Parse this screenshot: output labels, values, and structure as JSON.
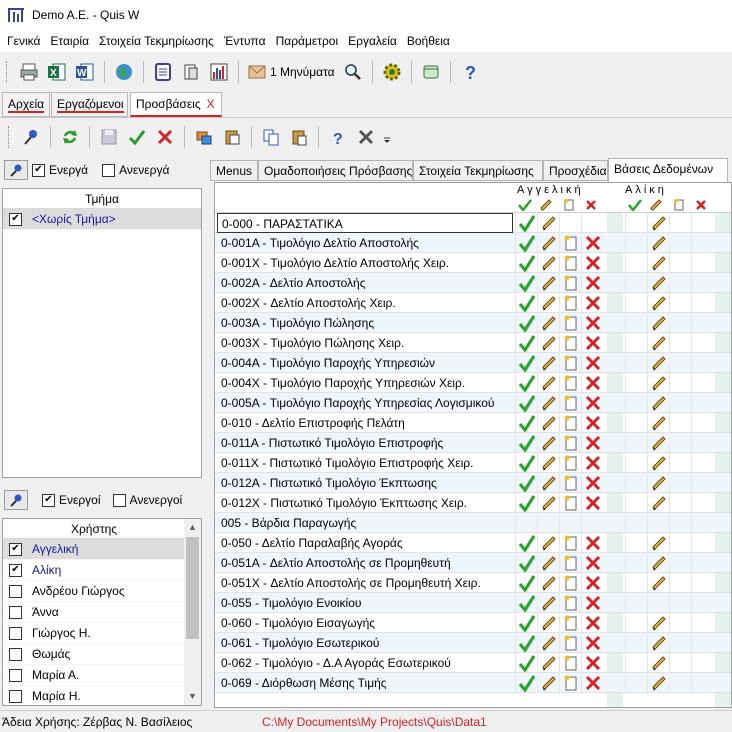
{
  "window": {
    "title": "Demo A.E. - Quis W"
  },
  "menu": [
    "Γενικά",
    "Εταιρία",
    "Στοιχεία Τεκμηρίωσης",
    "Έντυπα",
    "Παράμετροι",
    "Εργαλεία",
    "Βοήθεια"
  ],
  "toolbar": {
    "messages_label": "1 Μηνύματα"
  },
  "doc_tabs": [
    {
      "label": "Αρχεία"
    },
    {
      "label": "Εργαζόμενοι"
    },
    {
      "label": "Προσβάσεις",
      "close": "X"
    }
  ],
  "departments": {
    "active_label": "Ενεργά",
    "inactive_label": "Ανενεργά",
    "active_checked": true,
    "inactive_checked": false,
    "header": "Τμήμα",
    "items": [
      {
        "name": "<Χωρίς Τμήμα>",
        "checked": true
      }
    ]
  },
  "users": {
    "active_label": "Ενεργοί",
    "inactive_label": "Ανενεργοί",
    "active_checked": true,
    "inactive_checked": false,
    "header": "Χρήστης",
    "items": [
      {
        "name": "Αγγελική",
        "checked": true
      },
      {
        "name": "Αλίκη",
        "checked": true
      },
      {
        "name": "Ανδρέου Γιώργος",
        "checked": false
      },
      {
        "name": "Άννα",
        "checked": false
      },
      {
        "name": "Γιώργος Η.",
        "checked": false
      },
      {
        "name": "Θωμάς",
        "checked": false
      },
      {
        "name": "Μαρία Α.",
        "checked": false
      },
      {
        "name": "Μαρία Η.",
        "checked": false
      }
    ]
  },
  "grid_tabs": [
    "Menus",
    "Ομαδοποιήσεις Πρόσβασης",
    "Στοιχεία Τεκμηρίωσης",
    "Προσχέδια",
    "Βάσεις Δεδομένων"
  ],
  "grid": {
    "user_columns": [
      "Αγγελική",
      "Αλίκη"
    ],
    "rows": [
      {
        "name": "0-000 - ΠΑΡΑΣΤΑΤΙΚΑ",
        "a": [
          1,
          1,
          0,
          0
        ],
        "b": [
          0,
          1,
          0,
          0
        ]
      },
      {
        "name": "0-001A - Τιμολόγιο Δελτίο Αποστολής",
        "a": [
          1,
          1,
          1,
          1
        ],
        "b": [
          0,
          1,
          0,
          0
        ]
      },
      {
        "name": "0-001X - Τιμολόγιο Δελτίο Αποστολής Χειρ.",
        "a": [
          1,
          1,
          1,
          1
        ],
        "b": [
          0,
          1,
          0,
          0
        ]
      },
      {
        "name": "0-002A - Δελτίο Αποστολής",
        "a": [
          1,
          1,
          1,
          1
        ],
        "b": [
          0,
          1,
          0,
          0
        ]
      },
      {
        "name": "0-002X - Δελτίο Αποστολής Χειρ.",
        "a": [
          1,
          1,
          1,
          1
        ],
        "b": [
          0,
          1,
          0,
          0
        ]
      },
      {
        "name": "0-003A - Τιμολόγιο Πώλησης",
        "a": [
          1,
          1,
          1,
          1
        ],
        "b": [
          0,
          1,
          0,
          0
        ]
      },
      {
        "name": "0-003X - Τιμολόγιο Πώλησης Χειρ.",
        "a": [
          1,
          1,
          1,
          1
        ],
        "b": [
          0,
          1,
          0,
          0
        ]
      },
      {
        "name": "0-004A - Τιμολόγιο Παροχής Υπηρεσιών",
        "a": [
          1,
          1,
          1,
          1
        ],
        "b": [
          0,
          1,
          0,
          0
        ]
      },
      {
        "name": "0-004X - Τιμολόγιο Παροχής Υπηρεσιών Χειρ.",
        "a": [
          1,
          1,
          1,
          1
        ],
        "b": [
          0,
          1,
          0,
          0
        ]
      },
      {
        "name": "0-005A - Τιμολόγιο Παροχής Υπηρεσίας Λογισμικού",
        "a": [
          1,
          1,
          1,
          1
        ],
        "b": [
          0,
          1,
          0,
          0
        ]
      },
      {
        "name": "0-010 - Δελτίο Επιστροφής Πελάτη",
        "a": [
          1,
          1,
          1,
          1
        ],
        "b": [
          0,
          1,
          0,
          0
        ]
      },
      {
        "name": "0-011A - Πιστωτικό Τιμολόγιο Επιστροφής",
        "a": [
          1,
          1,
          1,
          1
        ],
        "b": [
          0,
          1,
          0,
          0
        ]
      },
      {
        "name": "0-011X - Πιστωτικό Τιμολόγιο Επιστροφής Χειρ.",
        "a": [
          1,
          1,
          1,
          1
        ],
        "b": [
          0,
          1,
          0,
          0
        ]
      },
      {
        "name": "0-012A - Πιστωτικό Τιμολόγιο Έκπτωσης",
        "a": [
          1,
          1,
          1,
          1
        ],
        "b": [
          0,
          1,
          0,
          0
        ]
      },
      {
        "name": "0-012X - Πιστωτικό Τιμολόγιο Έκπτωσης Χειρ.",
        "a": [
          1,
          1,
          1,
          1
        ],
        "b": [
          0,
          1,
          0,
          0
        ]
      },
      {
        "name": "005 - Βάρδια Παραγωγής",
        "a": [
          0,
          0,
          0,
          0
        ],
        "b": [
          0,
          0,
          0,
          0
        ]
      },
      {
        "name": "0-050 - Δελτίο Παραλαβής Αγοράς",
        "a": [
          1,
          1,
          1,
          1
        ],
        "b": [
          0,
          1,
          0,
          0
        ]
      },
      {
        "name": "0-051A - Δελτίο Αποστολής σε Προμηθευτή",
        "a": [
          1,
          1,
          1,
          1
        ],
        "b": [
          0,
          1,
          0,
          0
        ]
      },
      {
        "name": "0-051X - Δελτίο Αποστολής σε Προμηθευτή Χειρ.",
        "a": [
          1,
          1,
          1,
          1
        ],
        "b": [
          0,
          1,
          0,
          0
        ]
      },
      {
        "name": "0-055 - Τιμολόγιο Ενοικίου",
        "a": [
          1,
          1,
          1,
          1
        ],
        "b": [
          0,
          0,
          0,
          0
        ]
      },
      {
        "name": "0-060 - Τιμολόγιο Εισαγωγής",
        "a": [
          1,
          1,
          1,
          1
        ],
        "b": [
          0,
          1,
          0,
          0
        ]
      },
      {
        "name": "0-061 - Τιμολόγιο Εσωτερικού",
        "a": [
          1,
          1,
          1,
          1
        ],
        "b": [
          0,
          1,
          0,
          0
        ]
      },
      {
        "name": "0-062 - Τιμολόγιο - Δ.Α Αγοράς Εσωτερικού",
        "a": [
          1,
          1,
          1,
          1
        ],
        "b": [
          0,
          1,
          0,
          0
        ]
      },
      {
        "name": "0-069 - Διόρθωση Μέσης Τιμής",
        "a": [
          1,
          1,
          1,
          1
        ],
        "b": [
          0,
          1,
          0,
          0
        ]
      }
    ]
  },
  "status": {
    "user_label": "Άδεια Χρήσης: Ζέρβας Ν. Βασίλειος",
    "path": "C:\\My Documents\\My Projects\\Quis\\Data1"
  }
}
